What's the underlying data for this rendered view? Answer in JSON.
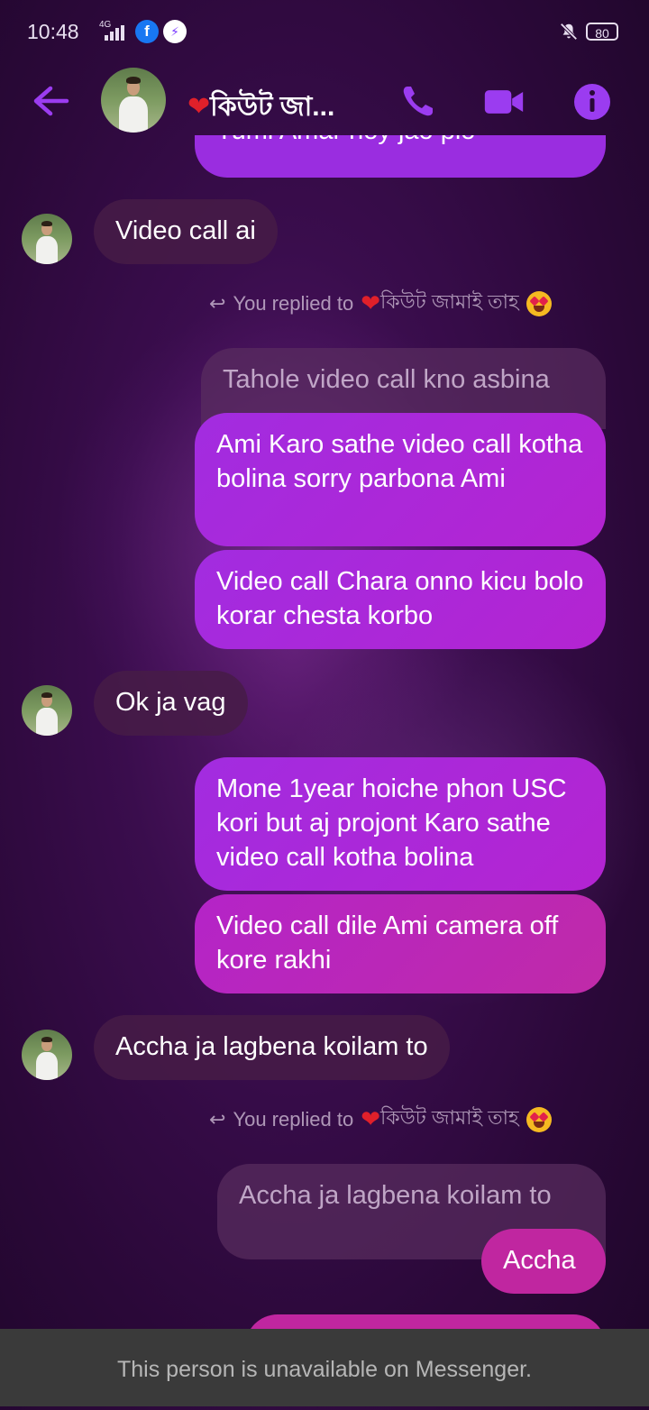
{
  "status_bar": {
    "time": "10:48",
    "network": "4G",
    "battery": "80"
  },
  "header": {
    "contact_name": "কিউট জা...",
    "colors": {
      "accent": "#9b3cf0"
    }
  },
  "messages": {
    "cut_top_text": "Tumi Amar hoy jao plo",
    "m1": "Video call ai",
    "reply1": {
      "prefix": "You replied to",
      "name": "কিউট জামাই তাহ"
    },
    "quoted1": "Tahole video call kno asbina",
    "m2": "Ami Karo sathe video call kotha bolina sorry parbona Ami",
    "m3": "Video call Chara onno kicu bolo korar chesta korbo",
    "m4": "Ok ja vag",
    "m5": "Mone 1year hoiche phon USC kori but aj projont Karo sathe video call kotha bolina",
    "m6": "Video call dile Ami camera off kore rakhi",
    "m7": "Accha ja lagbena koilam to",
    "reply2": {
      "prefix": "You replied to",
      "name": "কিউট জামাই তাহ"
    },
    "quoted2": "Accha ja lagbena koilam to",
    "m8": "Accha"
  },
  "footer": {
    "notice": "This person is unavailable on Messenger."
  }
}
